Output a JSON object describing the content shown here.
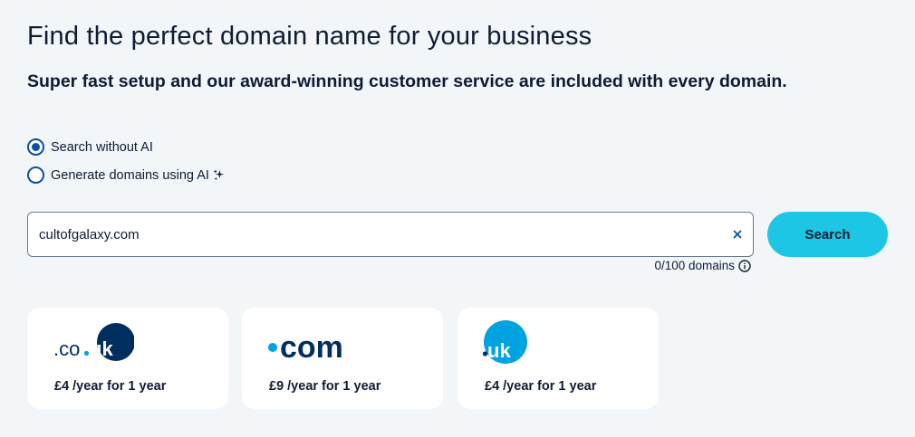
{
  "header": {
    "title": "Find the perfect domain name for your business",
    "subtitle": "Super fast setup and our award-winning customer service are included with every domain."
  },
  "search_mode": {
    "selected": "without_ai",
    "options": [
      {
        "label": "Search without AI",
        "checked": true
      },
      {
        "label": "Generate domains using AI",
        "checked": false,
        "icon": "sparkle-icon"
      }
    ]
  },
  "search": {
    "value": "cultofgalaxy.com",
    "clear_icon": "close-icon",
    "button_label": "Search",
    "counter_text": "0/100 domains",
    "counter_icon": "info-icon"
  },
  "colors": {
    "accent_button": "#1ec6e6",
    "radio": "#0b4fa0",
    "text": "#0f1c33",
    "background": "#f3f6f9",
    "logo_navy": "#002f5f",
    "logo_blue": "#00a3e0"
  },
  "domain_cards": [
    {
      "tld": ".co.uk",
      "logo_text": ".co",
      "logo_badge": "uk",
      "price_text": "£4 /year for 1 year"
    },
    {
      "tld": ".com",
      "logo_text": "com",
      "price_text": "£9 /year for 1 year"
    },
    {
      "tld": ".uk",
      "logo_badge": "uk",
      "price_text": "£4 /year for 1 year"
    }
  ]
}
